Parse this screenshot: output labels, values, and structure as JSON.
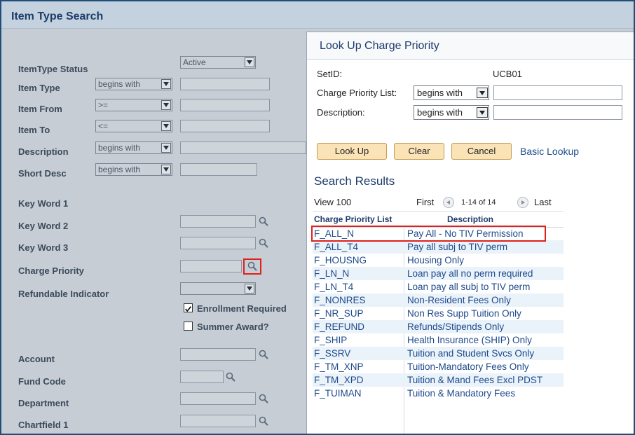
{
  "page": {
    "title": "Item Type Search"
  },
  "form": {
    "itemtype_status": {
      "label": "ItemType Status",
      "value": "Active"
    },
    "item_type": {
      "label": "Item Type",
      "operator": "begins with"
    },
    "item_from": {
      "label": "Item From",
      "operator": ">="
    },
    "item_to": {
      "label": "Item To",
      "operator": "<="
    },
    "description": {
      "label": "Description",
      "operator": "begins with"
    },
    "short_desc": {
      "label": "Short Desc",
      "operator": "begins with"
    },
    "key_word_1": {
      "label": "Key Word 1"
    },
    "key_word_2": {
      "label": "Key Word 2"
    },
    "key_word_3": {
      "label": "Key Word 3"
    },
    "charge_priority": {
      "label": "Charge Priority"
    },
    "refundable_indicator": {
      "label": "Refundable Indicator"
    },
    "enrollment_required": {
      "label": "Enrollment Required",
      "checked": true
    },
    "summer_award": {
      "label": "Summer Award?",
      "checked": false
    },
    "account": {
      "label": "Account"
    },
    "fund_code": {
      "label": "Fund Code"
    },
    "department": {
      "label": "Department"
    },
    "chartfield_1": {
      "label": "Chartfield 1"
    }
  },
  "lookup": {
    "title": "Look Up Charge Priority",
    "setid_label": "SetID:",
    "setid_value": "UCB01",
    "cpl_label": "Charge Priority List:",
    "cpl_operator": "begins with",
    "desc_label": "Description:",
    "desc_operator": "begins with",
    "buttons": {
      "lookup": "Look Up",
      "clear": "Clear",
      "cancel": "Cancel",
      "basic": "Basic Lookup"
    },
    "results_title": "Search Results",
    "nav": {
      "view": "View 100",
      "first": "First",
      "range": "1-14 of 14",
      "last": "Last"
    },
    "columns": [
      "Charge Priority List",
      "Description"
    ],
    "rows": [
      {
        "code": "F_ALL_N",
        "desc": "Pay All - No TIV Permission"
      },
      {
        "code": "F_ALL_T4",
        "desc": "Pay all subj to TIV perm"
      },
      {
        "code": "F_HOUSNG",
        "desc": "Housing Only"
      },
      {
        "code": "F_LN_N",
        "desc": "Loan pay all no perm required"
      },
      {
        "code": "F_LN_T4",
        "desc": "Loan pay all subj to TIV perm"
      },
      {
        "code": "F_NONRES",
        "desc": "Non-Resident Fees Only"
      },
      {
        "code": "F_NR_SUP",
        "desc": "Non Res Supp Tuition Only"
      },
      {
        "code": "F_REFUND",
        "desc": "Refunds/Stipends Only"
      },
      {
        "code": "F_SHIP",
        "desc": "Health Insurance (SHIP) Only"
      },
      {
        "code": "F_SSRV",
        "desc": "Tuition and Student Svcs Only"
      },
      {
        "code": "F_TM_XNP",
        "desc": "Tuition-Mandatory Fees Only"
      },
      {
        "code": "F_TM_XPD",
        "desc": "Tuition & Mand Fees Excl PDST"
      },
      {
        "code": "F_TUIMAN",
        "desc": "Tuition & Mandatory Fees"
      }
    ]
  },
  "icons": {
    "lookup": "magnifier-icon",
    "prev": "left-arrow-icon",
    "next": "right-arrow-icon",
    "dropdown": "chevron-down-icon"
  },
  "colors": {
    "highlight": "#e0201c",
    "link": "#1e4a8c",
    "button": "#fbe3b8"
  }
}
